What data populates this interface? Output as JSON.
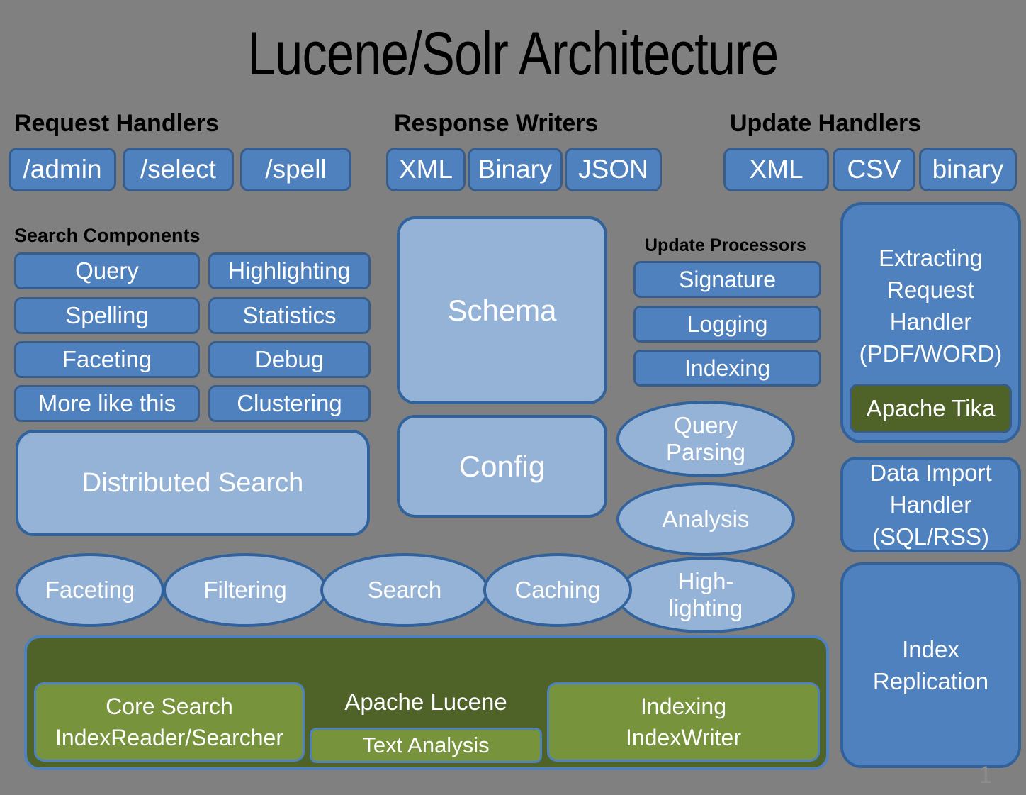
{
  "title": "Lucene/Solr Architecture",
  "page_number": "1",
  "colors": {
    "background": "#808080",
    "blue_mid": "#4E81BD",
    "blue_mid_border": "#385D8A",
    "blue_light": "#95B3D7",
    "blue_light_border": "#31629C",
    "green_dark": "#4F6228",
    "green_light": "#77933C",
    "text_on_shape": "#FFFFFF",
    "caption_text": "#000000"
  },
  "sections": {
    "request_handlers": {
      "caption": "Request Handlers",
      "items": [
        "/admin",
        "/select",
        "/spell"
      ]
    },
    "response_writers": {
      "caption": "Response Writers",
      "items": [
        "XML",
        "Binary",
        "JSON"
      ]
    },
    "update_handlers": {
      "caption": "Update Handlers",
      "items": [
        "XML",
        "CSV",
        "binary"
      ]
    },
    "search_components": {
      "caption": "Search Components",
      "items_left": [
        "Query",
        "Spelling",
        "Faceting",
        "More like this"
      ],
      "items_right": [
        "Highlighting",
        "Statistics",
        "Debug",
        "Clustering"
      ]
    },
    "update_processors": {
      "caption": "Update Processors",
      "items": [
        "Signature",
        "Logging",
        "Indexing"
      ]
    }
  },
  "blocks": {
    "schema": "Schema",
    "config": "Config",
    "distributed_search": "Distributed Search",
    "extracting_request_handler": "Extracting\nRequest\nHandler\n(PDF/WORD)",
    "apache_tika": "Apache Tika",
    "data_import_handler": "Data Import\nHandler\n(SQL/RSS)",
    "index_replication": "Index\nReplication"
  },
  "ellipses_right": [
    "Query\nParsing",
    "Analysis",
    "High-\nlighting"
  ],
  "ellipses_bottom": [
    "Faceting",
    "Filtering",
    "Search",
    "Caching"
  ],
  "lucene": {
    "label": "Apache Lucene",
    "core_search": "Core Search\nIndexReader/Searcher",
    "text_analysis": "Text Analysis",
    "indexing": "Indexing\nIndexWriter"
  }
}
